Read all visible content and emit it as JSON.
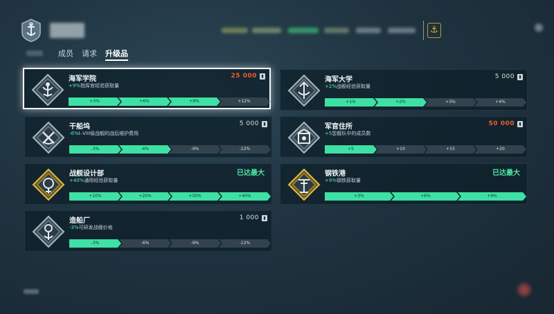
{
  "tabs": {
    "members": "成员",
    "requests": "请求",
    "upgrades": "升级品"
  },
  "colors": {
    "active_level": "#3fe0a4",
    "inactive_level": "#33434e",
    "cost_red": "#f05a2a",
    "maxed": "#50e3a4"
  },
  "cards": [
    {
      "title": "海军学院",
      "desc_value": "+9%",
      "desc_text": "指挥官经验获取量",
      "cost": "25 000",
      "cost_red": true,
      "maxed": null,
      "icon": "naval-academy-icon",
      "levels": [
        "+3%",
        "+6%",
        "+9%",
        "+12%"
      ],
      "active": 3
    },
    {
      "title": "海军大学",
      "desc_value": "+2%",
      "desc_text": "战舰经验获取量",
      "cost": "5 000",
      "cost_red": false,
      "maxed": null,
      "icon": "naval-university-icon",
      "levels": [
        "+1%",
        "+2%",
        "+3%",
        "+4%"
      ],
      "active": 2
    },
    {
      "title": "干船坞",
      "desc_value": "-6%",
      "desc_text": "I–VIII级战舰的战后维护费用",
      "cost": "5 000",
      "cost_red": false,
      "maxed": null,
      "icon": "dry-dock-icon",
      "levels": [
        "-3%",
        "-6%",
        "-9%",
        "-12%"
      ],
      "active": 2
    },
    {
      "title": "军官住所",
      "desc_value": "+5",
      "desc_text": "您舰队中的成员数",
      "cost": "50 000",
      "cost_red": true,
      "maxed": null,
      "icon": "officers-club-icon",
      "levels": [
        "+5",
        "+10",
        "+15",
        "+20"
      ],
      "active": 1
    },
    {
      "title": "战舰设计部",
      "desc_value": "+40%",
      "desc_text": "通用经验获取量",
      "cost": null,
      "cost_red": false,
      "maxed": "已达最大",
      "icon": "design-department-icon",
      "levels": [
        "+10%",
        "+20%",
        "+30%",
        "+40%"
      ],
      "active": 4
    },
    {
      "title": "钢铁港",
      "desc_value": "+9%",
      "desc_text": "钢铁获取量",
      "cost": null,
      "cost_red": false,
      "maxed": "已达最大",
      "icon": "steel-harbor-icon",
      "levels": [
        "+3%",
        "+6%",
        "+9%"
      ],
      "active": 3
    },
    {
      "title": "造船厂",
      "desc_value": "-3%",
      "desc_text": "可研发战舰价格",
      "cost": "1 000",
      "cost_red": false,
      "maxed": null,
      "icon": "shipyard-icon",
      "levels": [
        "-3%",
        "-6%",
        "-9%",
        "-12%"
      ],
      "active": 1
    }
  ]
}
